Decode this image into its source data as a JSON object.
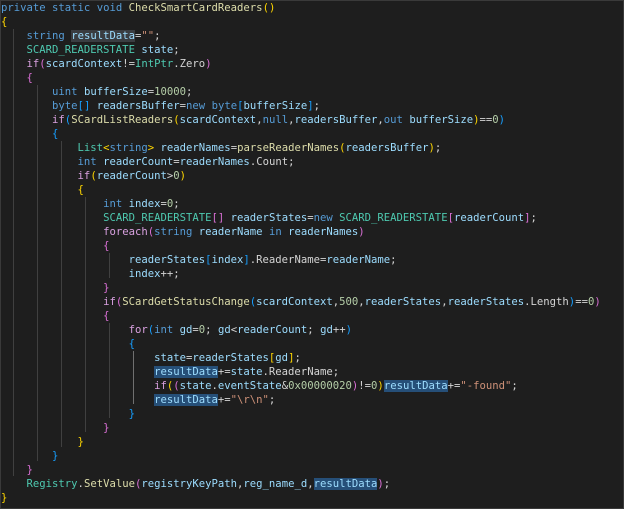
{
  "editor": {
    "language": "csharp",
    "theme": {
      "background": "#1e1e1e",
      "keyword": "#569cd6",
      "control_keyword": "#d8a0df",
      "type": "#4ec9b0",
      "method": "#dcdcaa",
      "variable": "#9cdcfe",
      "string": "#ce9178",
      "number": "#b5cea8",
      "plain": "#d4d4d4",
      "bracket_level_1": "#ffd700",
      "bracket_level_2": "#da70d6",
      "bracket_level_3": "#179fff",
      "selection": "#264f78",
      "word_highlight": "#3a3d41"
    },
    "code_lines": [
      "private static void CheckSmartCardReaders()",
      "{",
      "    string resultData=\"\";",
      "    SCARD_READERSTATE state;",
      "    if(scardContext!=IntPtr.Zero)",
      "    {",
      "        uint bufferSize=10000;",
      "        byte[] readersBuffer=new byte[bufferSize];",
      "        if(SCardListReaders(scardContext,null,readersBuffer,out bufferSize)==0)",
      "        {",
      "            List<string> readerNames=parseReaderNames(readersBuffer);",
      "            int readerCount=readerNames.Count;",
      "            if(readerCount>0)",
      "            {",
      "                int index=0;",
      "                SCARD_READERSTATE[] readerStates=new SCARD_READERSTATE[readerCount];",
      "                foreach(string readerName in readerNames)",
      "                {",
      "                    readerStates[index].ReaderName=readerName;",
      "                    index++;",
      "                }",
      "                if(SCardGetStatusChange(scardContext,500,readerStates,readerStates.Length)==0)",
      "                {",
      "                    for(int gd=0; gd<readerCount; gd++)",
      "                    {",
      "                        state=readerStates[gd];",
      "                        resultData+=state.ReaderName;",
      "                        if((state.eventState&0x00000020)!=0)resultData+=\"-found\";",
      "                        resultData+=\"\\r\\n\";",
      "                    }",
      "                }",
      "            }",
      "        }",
      "    }",
      "    Registry.SetValue(registryKeyPath,reg_name_d,resultData);",
      "}"
    ]
  }
}
